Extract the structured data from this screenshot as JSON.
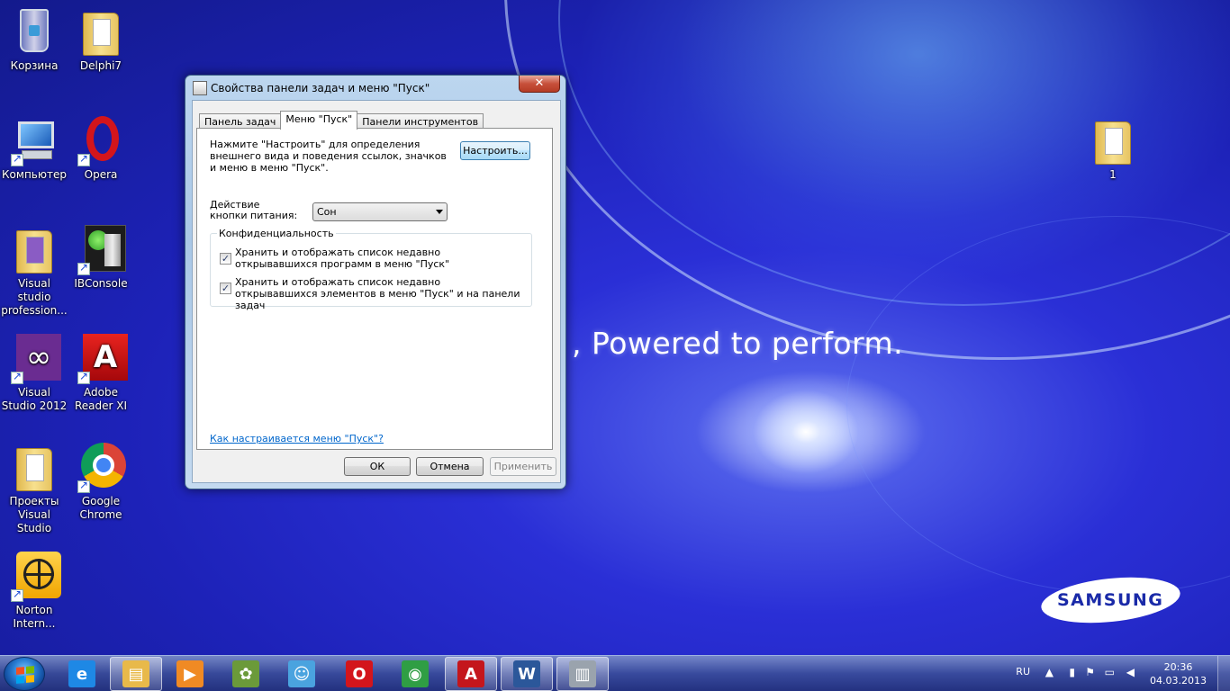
{
  "desktop": {
    "slogan": ", Powered to perform.",
    "brand_logo": "SAMSUNG",
    "icons": [
      {
        "label": "Корзина",
        "icon": "recycle-bin-icon"
      },
      {
        "label": "Delphi7",
        "icon": "folder-icon"
      },
      {
        "label": "Компьютер",
        "icon": "computer-icon"
      },
      {
        "label": "Opera",
        "icon": "opera-icon"
      },
      {
        "label": "Visual studio profession...",
        "icon": "folder-icon"
      },
      {
        "label": "IBConsole",
        "icon": "ibconsole-icon"
      },
      {
        "label": "Visual Studio 2012",
        "icon": "visual-studio-icon"
      },
      {
        "label": "Adobe Reader XI",
        "icon": "adobe-reader-icon"
      },
      {
        "label": "Проекты Visual Studio",
        "icon": "folder-icon"
      },
      {
        "label": "Google Chrome",
        "icon": "chrome-icon"
      },
      {
        "label": "Norton Intern...",
        "icon": "norton-icon"
      },
      {
        "label": "1",
        "icon": "folder-icon"
      }
    ]
  },
  "dialog": {
    "title": "Свойства панели задач и меню \"Пуск\"",
    "close_glyph": "✕",
    "tabs": [
      {
        "label": "Панель задач",
        "active": false
      },
      {
        "label": "Меню \"Пуск\"",
        "active": true
      },
      {
        "label": "Панели инструментов",
        "active": false
      }
    ],
    "description": "Нажмите \"Настроить\" для определения внешнего вида и поведения ссылок, значков и меню в меню \"Пуск\".",
    "customize_button": "Настроить...",
    "power_label": "Действие кнопки питания:",
    "power_value": "Сон",
    "privacy_group": "Конфиденциальность",
    "checkboxes": [
      {
        "label": "Хранить и отображать список недавно открывавшихся программ в меню \"Пуск\"",
        "checked": true
      },
      {
        "label": "Хранить и отображать список недавно открывавшихся элементов в меню \"Пуск\" и на панели задач",
        "checked": true
      }
    ],
    "help_link": "Как настраивается меню \"Пуск\"?",
    "ok_button": "ОК",
    "cancel_button": "Отмена",
    "apply_button": "Применить"
  },
  "taskbar": {
    "pinned": [
      {
        "name": "internet-explorer-icon",
        "glyph": "e",
        "color": "#1e88e5",
        "active": false
      },
      {
        "name": "explorer-icon",
        "glyph": "▤",
        "color": "#e8b94a",
        "active": true
      },
      {
        "name": "media-player-icon",
        "glyph": "▶",
        "color": "#f08a24",
        "active": false
      },
      {
        "name": "app-icon",
        "glyph": "✿",
        "color": "#6b9a3a",
        "active": false
      },
      {
        "name": "messenger-icon",
        "glyph": "☺",
        "color": "#4aa3df",
        "active": false
      },
      {
        "name": "opera-icon",
        "glyph": "O",
        "color": "#d3151c",
        "active": false
      },
      {
        "name": "chrome-icon",
        "glyph": "◉",
        "color": "#2f9e44",
        "active": false
      },
      {
        "name": "adobe-reader-icon",
        "glyph": "A",
        "color": "#c4161c",
        "active": true
      },
      {
        "name": "word-icon",
        "glyph": "W",
        "color": "#2b579a",
        "active": true
      },
      {
        "name": "taskbar-properties-icon",
        "glyph": "▥",
        "color": "#9aa3ad",
        "active": true
      }
    ],
    "language": "RU",
    "time": "20:36",
    "date": "04.03.2013",
    "colors": {
      "accent": "#2a2fd6",
      "link": "#0066cc"
    }
  }
}
